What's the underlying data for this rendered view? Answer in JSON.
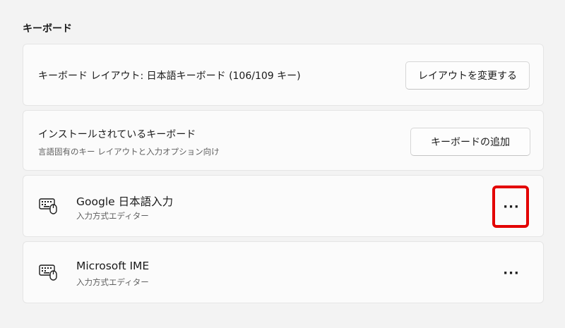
{
  "section": {
    "title": "キーボード"
  },
  "layout_card": {
    "label": "キーボード レイアウト: 日本語キーボード (106/109 キー)",
    "button_label": "レイアウトを変更する"
  },
  "installed_card": {
    "label": "インストールされているキーボード",
    "sublabel": "言語固有のキー レイアウトと入力オプション向け",
    "button_label": "キーボードの追加"
  },
  "keyboards": [
    {
      "name": "Google 日本語入力",
      "type": "入力方式エディター",
      "icon": "keyboard-mouse-icon",
      "more_label": "···"
    },
    {
      "name": "Microsoft IME",
      "type": "入力方式エディター",
      "icon": "keyboard-mouse-icon",
      "more_label": "···"
    }
  ],
  "annotation": {
    "highlight_color": "#e30000"
  }
}
